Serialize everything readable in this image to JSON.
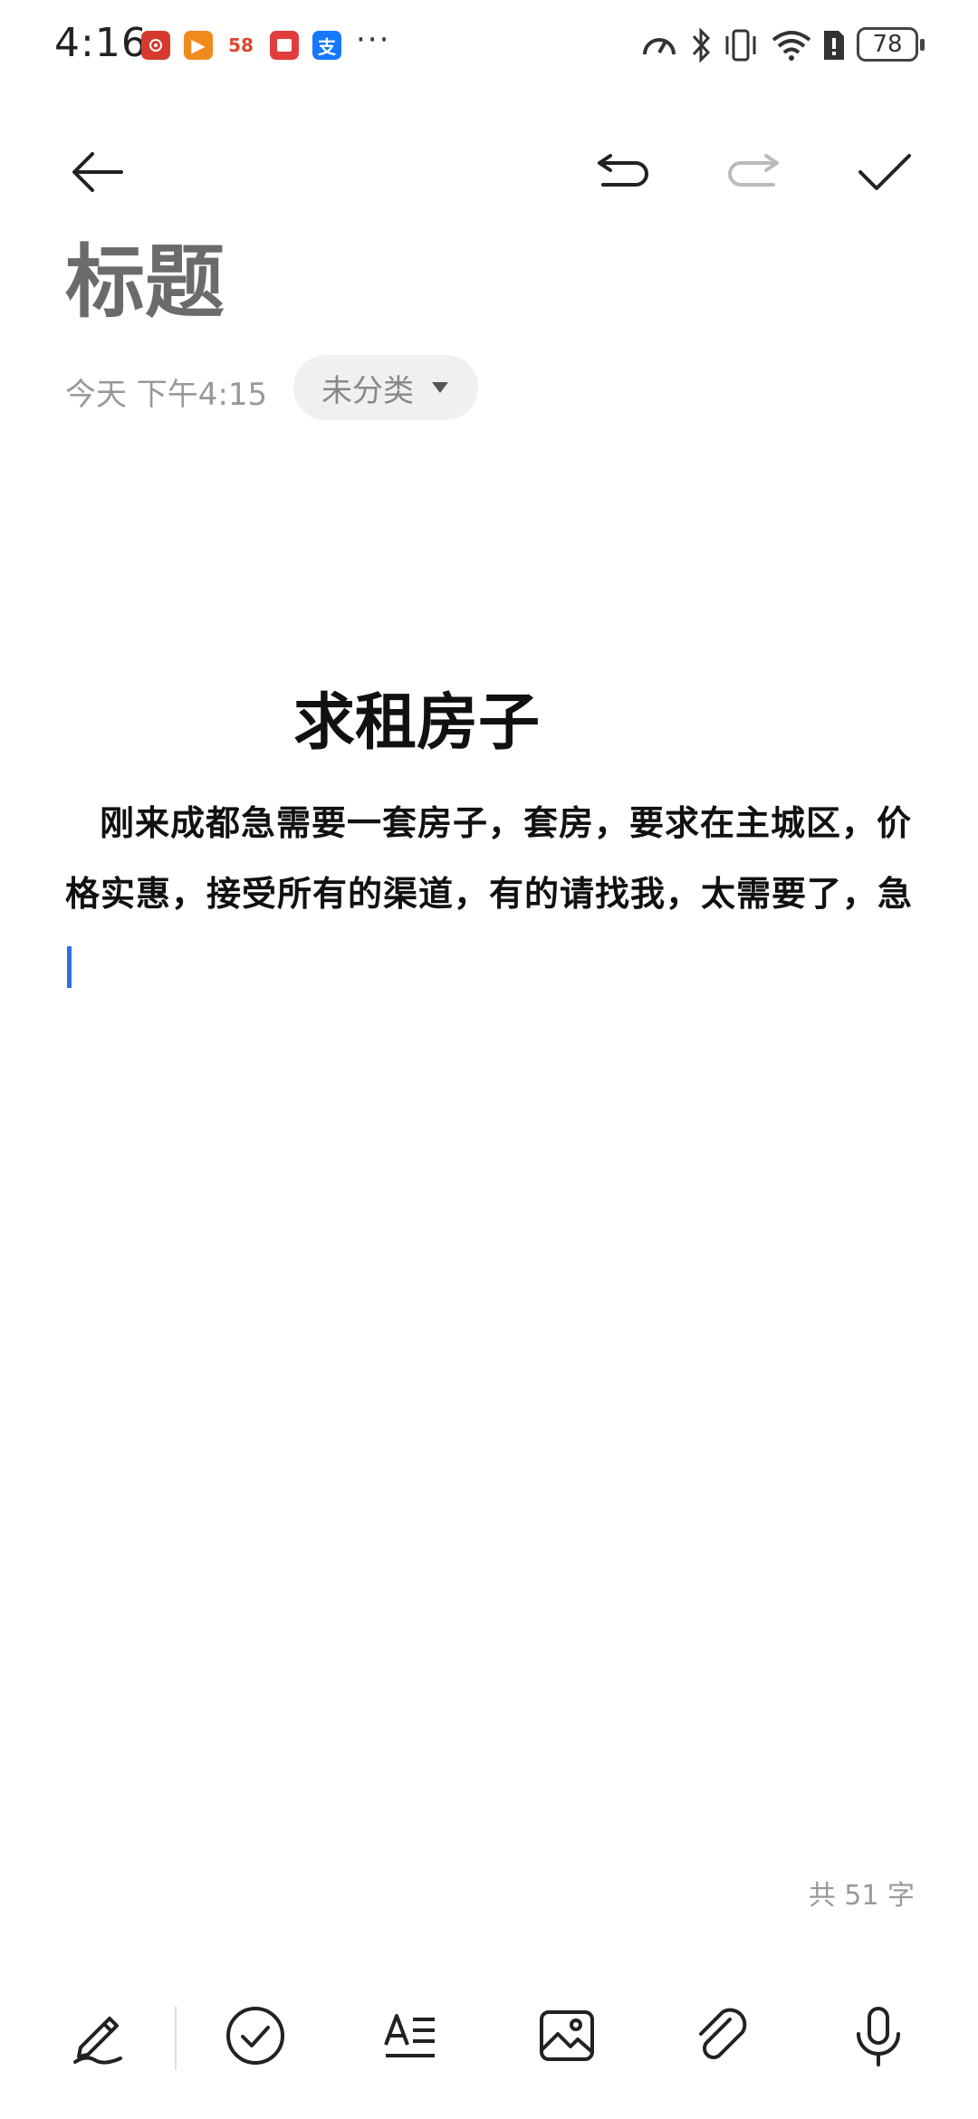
{
  "status_bar": {
    "time": "4:16",
    "app_icons": [
      "weather-app-icon",
      "video-app-icon",
      "58-app-icon",
      "reader-app-icon",
      "alipay-app-icon"
    ],
    "app_icon_texts": [
      "",
      "▶",
      "58",
      "",
      "支"
    ],
    "more": "···",
    "battery": "78"
  },
  "note": {
    "title_placeholder": "标题",
    "date": "今天 下午4:15",
    "category": "未分类"
  },
  "content": {
    "heading": "求租房子",
    "body": "刚来成都急需要一套房子，套房，要求在主城区，价格实惠，接受所有的渠道，有的请找我，太需要了，急"
  },
  "footer": {
    "word_count": "共 51 字"
  },
  "colors": {
    "accent": "#2f6fe0",
    "title_placeholder": "#6b6b6b",
    "secondary_text": "#999999"
  }
}
